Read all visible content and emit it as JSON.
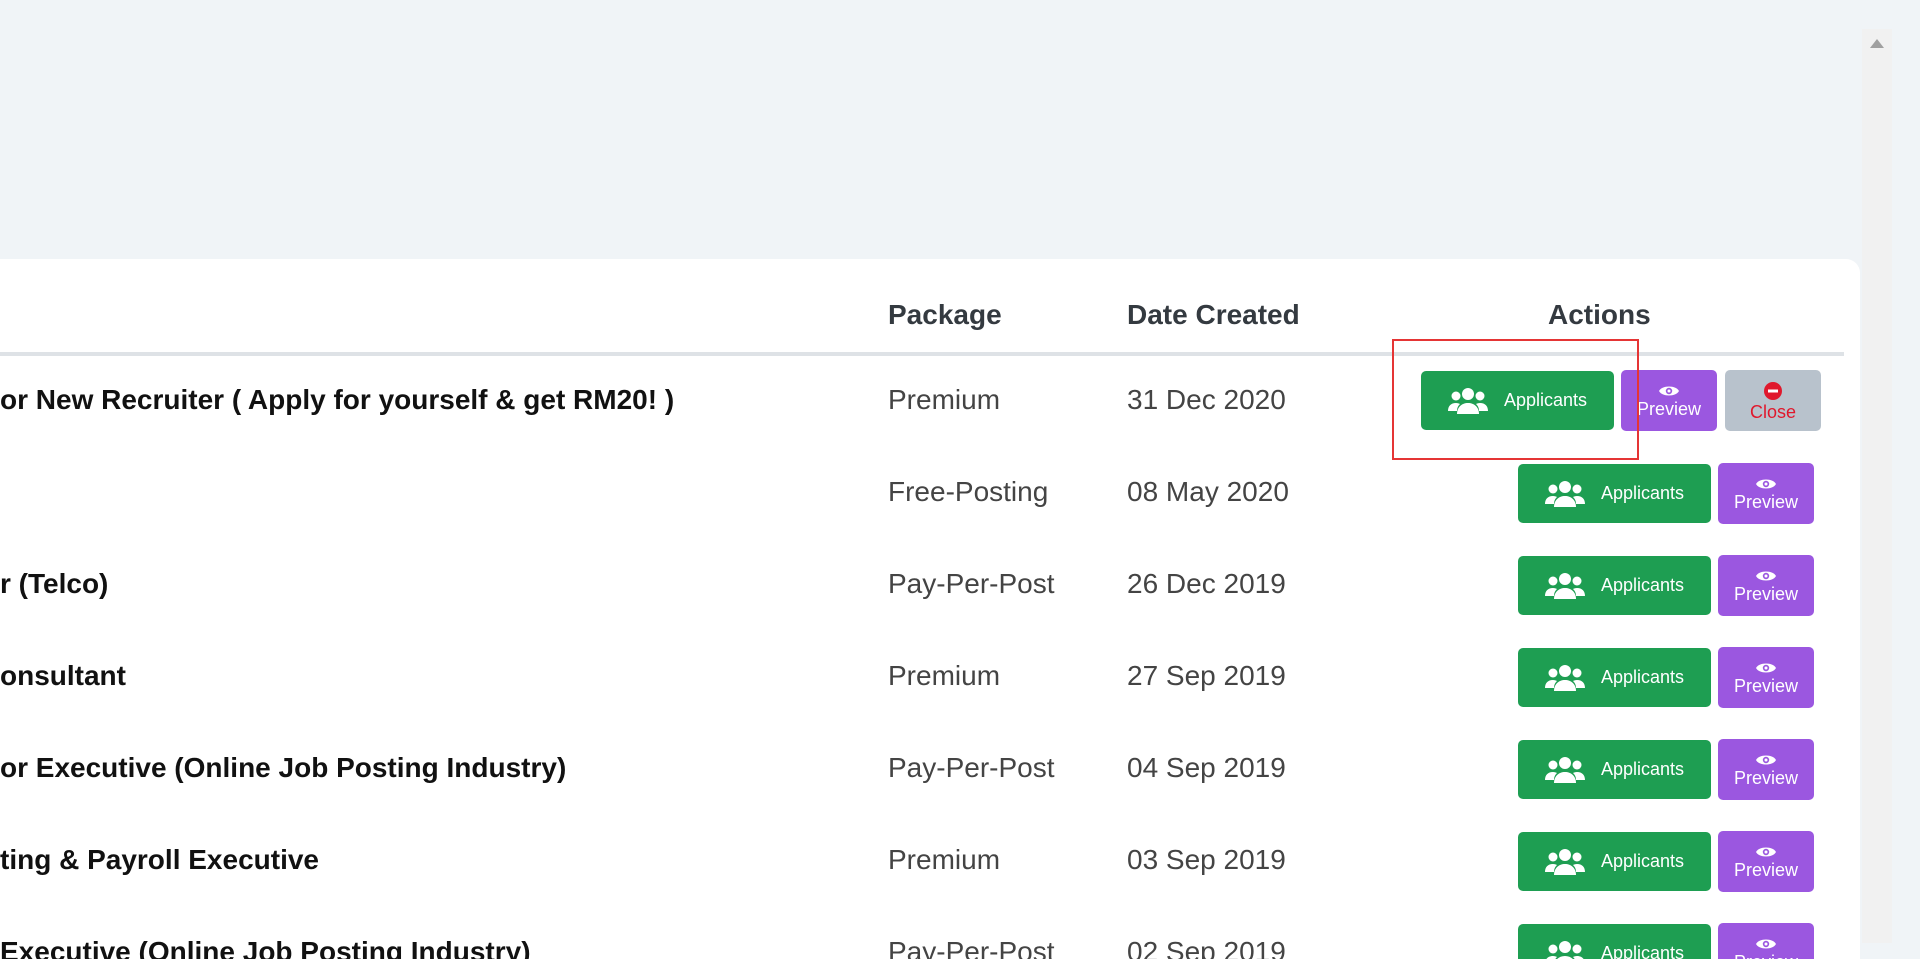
{
  "table": {
    "headers": {
      "package": "Package",
      "date_created": "Date Created",
      "actions": "Actions"
    },
    "rows": [
      {
        "title": "or New Recruiter ( Apply for yourself & get RM20! )",
        "package": "Premium",
        "date": "31 Dec 2020",
        "has_close": true
      },
      {
        "title": "",
        "package": "Free-Posting",
        "date": "08 May 2020",
        "has_close": false
      },
      {
        "title": "r (Telco)",
        "package": "Pay-Per-Post",
        "date": "26 Dec 2019",
        "has_close": false
      },
      {
        "title": "onsultant",
        "package": "Premium",
        "date": "27 Sep 2019",
        "has_close": false
      },
      {
        "title": "or Executive (Online Job Posting Industry)",
        "package": "Pay-Per-Post",
        "date": "04 Sep 2019",
        "has_close": false
      },
      {
        "title": "ting & Payroll Executive",
        "package": "Premium",
        "date": "03 Sep 2019",
        "has_close": false
      },
      {
        "title": "Executive (Online Job Posting Industry)",
        "package": "Pay-Per-Post",
        "date": "02 Sep 2019",
        "has_close": false
      }
    ]
  },
  "actions": {
    "applicants_label": "Applicants",
    "preview_label": "Preview",
    "close_label": "Close"
  },
  "icons": {
    "applicants": "users-icon",
    "preview": "eye-icon",
    "close": "minus-circle-icon"
  },
  "colors": {
    "applicants_button": "#1e9e52",
    "preview_button": "#9b57e0",
    "close_button": "#b8c2cc",
    "close_text": "#e0182c",
    "highlight_box": "#e53535"
  }
}
